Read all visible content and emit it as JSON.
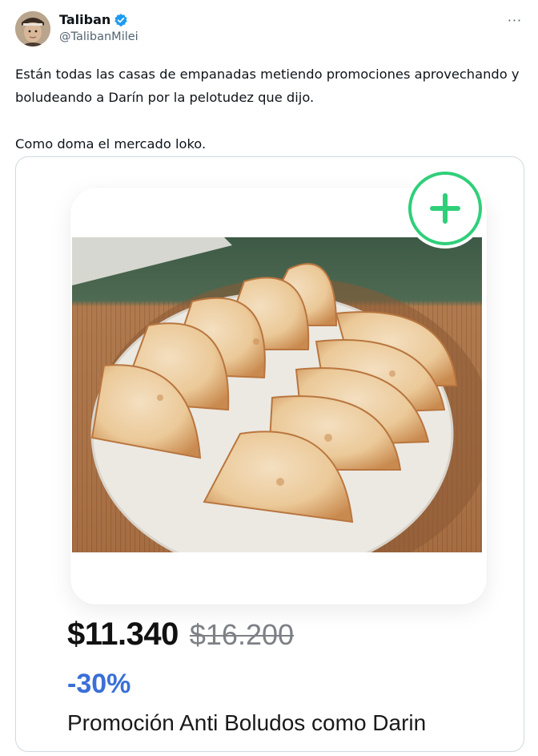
{
  "author": {
    "display_name": "Taliban",
    "handle": "@TalibanMilei",
    "verified": true,
    "avatar_icon": "avatar-portrait"
  },
  "actions": {
    "more_icon": "more-horizontal-icon",
    "more_label": "···"
  },
  "tweet": {
    "text": "Están todas las casas de empanadas metiendo promociones aprovechando y boludeando a Darín por la pelotudez que dijo.\n\nComo doma el mercado loko."
  },
  "product_card": {
    "image_subject": "empanadas",
    "add_icon": "plus-circle-icon",
    "price_current": "$11.340",
    "price_original": "$16.200",
    "discount": "-30%",
    "title": "Promoción Anti Boludos como Darin",
    "colors": {
      "add_accent": "#2fcf7a",
      "discount": "#3a6fd8",
      "verified": "#1d9bf0"
    }
  }
}
